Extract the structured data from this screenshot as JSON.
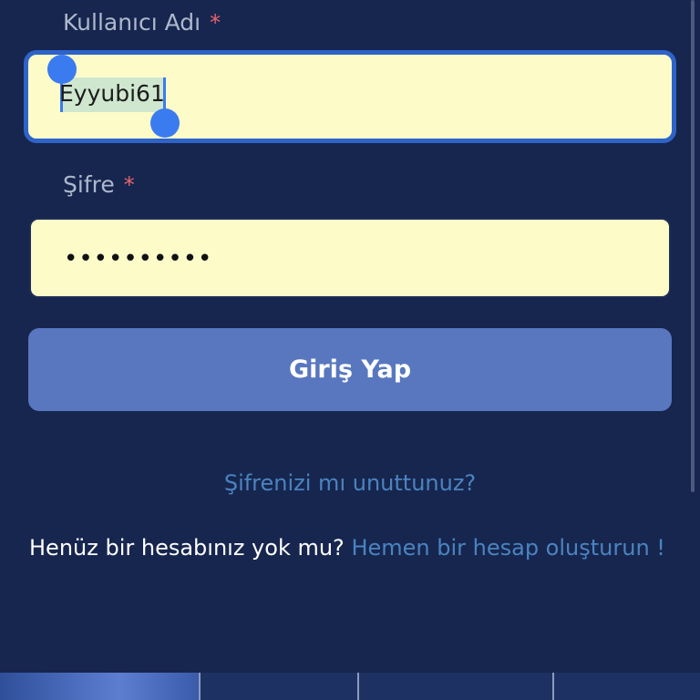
{
  "username": {
    "label": "Kullanıcı Adı",
    "required_mark": "*",
    "value": "Eyyubi61"
  },
  "password": {
    "label": "Şifre",
    "required_mark": "*",
    "masked_value": "••••••••••"
  },
  "login_button": {
    "label": "Giriş Yap"
  },
  "forgot_password": {
    "label": "Şifrenizi mı unuttunuz?"
  },
  "signup": {
    "prompt": "Henüz bir hesabınız yok mu?",
    "link": "Hemen bir hesap oluşturun !"
  },
  "colors": {
    "background": "#17264f",
    "field_fill": "#fdfcc9",
    "focus_border": "#2e63c8",
    "button": "#5877bf",
    "link": "#4a84c0",
    "required": "#e8646e"
  }
}
